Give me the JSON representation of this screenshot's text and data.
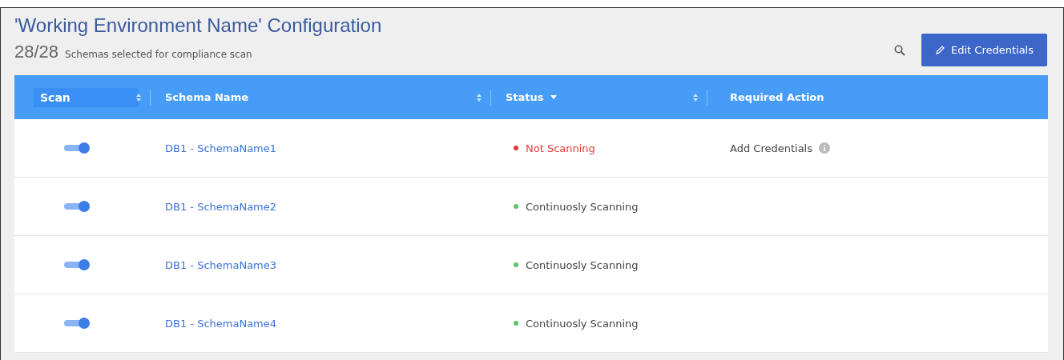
{
  "title": "'Working Environment Name' Configuration",
  "summary": {
    "count": "28/28",
    "label": "Schemas selected for compliance scan"
  },
  "edit_button": {
    "label": "Edit Credentials"
  },
  "table": {
    "columns": [
      {
        "label": "Scan",
        "sortable": true,
        "sorted": false,
        "highlighted": true
      },
      {
        "label": "Schema Name",
        "sortable": true,
        "sorted": false,
        "highlighted": false
      },
      {
        "label": "Status",
        "sortable": true,
        "sorted": true,
        "highlighted": false
      },
      {
        "label": "Required Action",
        "sortable": false,
        "sorted": false,
        "highlighted": false
      }
    ],
    "rows": [
      {
        "scan_on": true,
        "name": "DB1 - SchemaName1",
        "status": {
          "text": "Not Scanning",
          "kind": "error",
          "color": "#e53935"
        },
        "action": "Add Credentials"
      },
      {
        "scan_on": true,
        "name": "DB1 - SchemaName2",
        "status": {
          "text": "Continuosly Scanning",
          "kind": "normal",
          "color": "#5cc46a"
        }
      },
      {
        "scan_on": true,
        "name": "DB1 - SchemaName3",
        "status": {
          "text": "Continuosly Scanning",
          "kind": "normal",
          "color": "#5cc46a"
        }
      },
      {
        "scan_on": true,
        "name": "DB1 - SchemaName4",
        "status": {
          "text": "Continuosly Scanning",
          "kind": "normal",
          "color": "#5cc46a"
        }
      }
    ]
  }
}
